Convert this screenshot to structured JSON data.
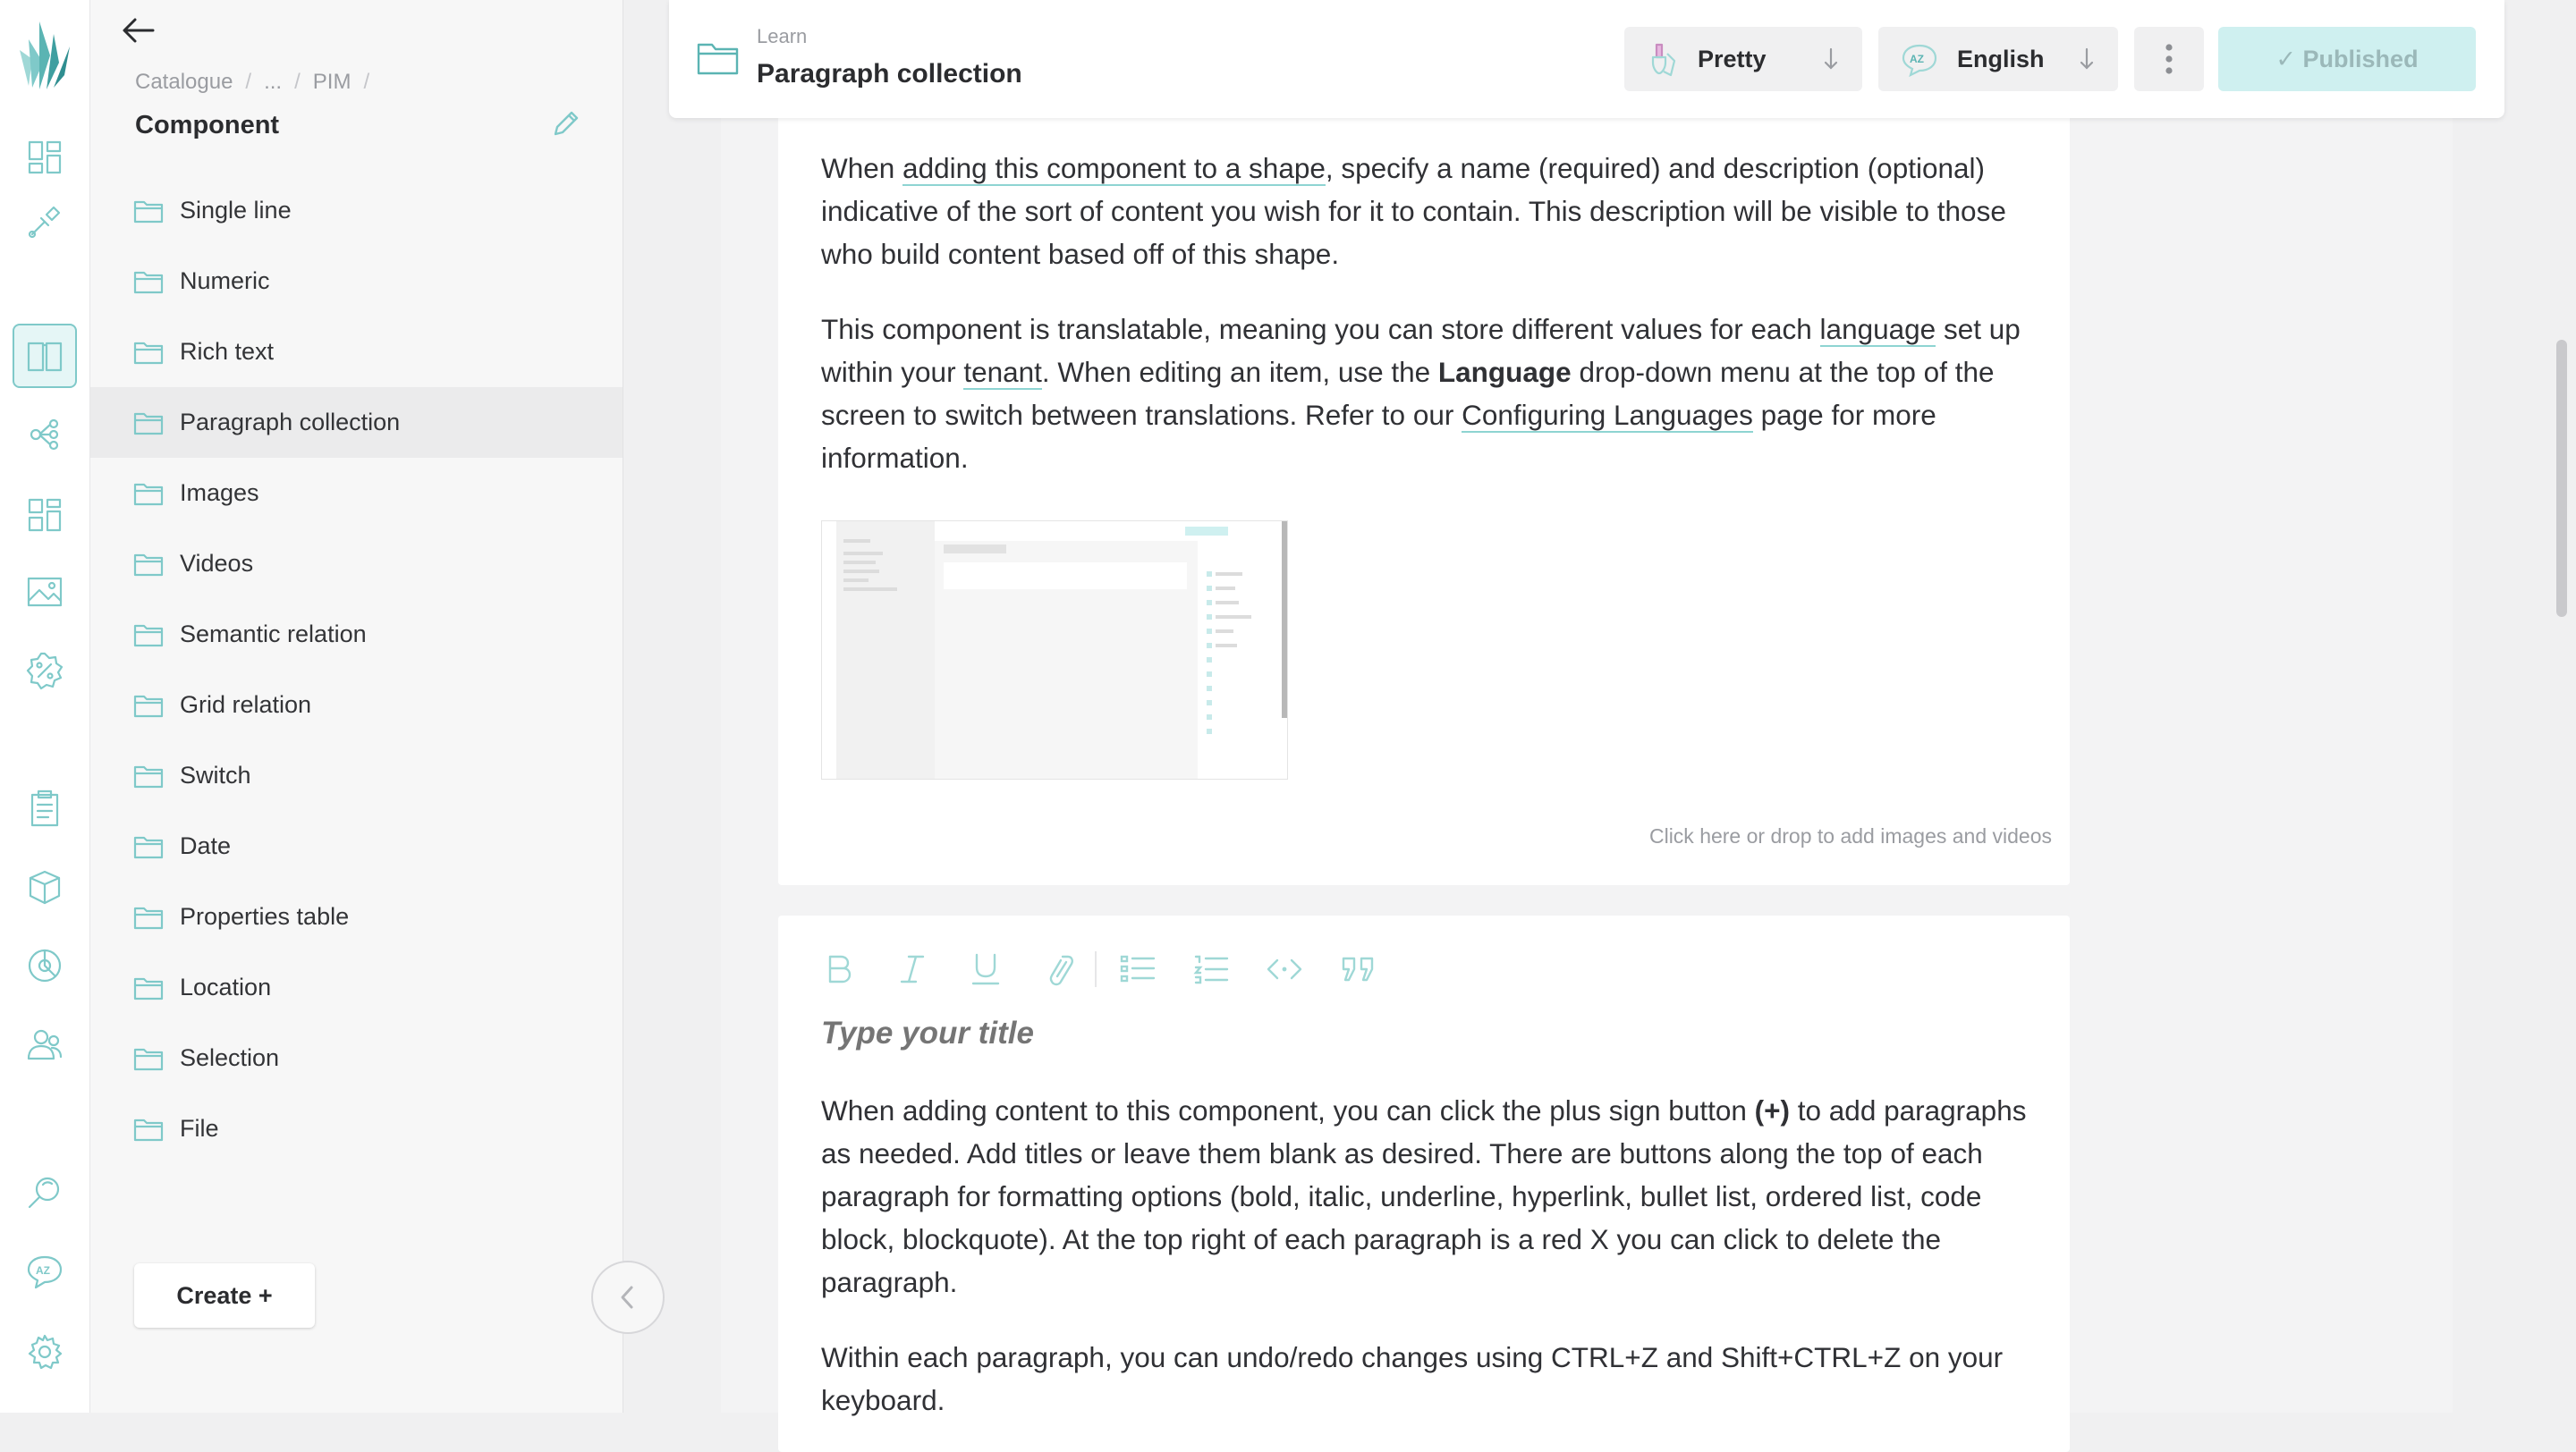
{
  "sidebar_rail": {
    "items": [
      {
        "icon": "dashboard-icon"
      },
      {
        "icon": "pipette-icon"
      },
      {
        "icon": "book-icon"
      },
      {
        "icon": "shapes-icon"
      },
      {
        "icon": "grid-icon"
      },
      {
        "icon": "image-icon"
      },
      {
        "icon": "percent-icon"
      },
      {
        "icon": "clipboard-icon"
      },
      {
        "icon": "box-icon"
      },
      {
        "icon": "chart-pie-icon"
      },
      {
        "icon": "users-icon"
      },
      {
        "icon": "search-icon"
      },
      {
        "icon": "translate-icon"
      },
      {
        "icon": "gear-icon"
      }
    ]
  },
  "tree": {
    "breadcrumb": [
      "Catalogue",
      "...",
      "PIM"
    ],
    "title": "Component",
    "items": [
      {
        "label": "Single line"
      },
      {
        "label": "Numeric"
      },
      {
        "label": "Rich text"
      },
      {
        "label": "Paragraph collection",
        "selected": true
      },
      {
        "label": "Images"
      },
      {
        "label": "Videos"
      },
      {
        "label": "Semantic relation"
      },
      {
        "label": "Grid relation"
      },
      {
        "label": "Switch"
      },
      {
        "label": "Date"
      },
      {
        "label": "Properties table"
      },
      {
        "label": "Location"
      },
      {
        "label": "Selection"
      },
      {
        "label": "File"
      }
    ],
    "create_label": "Create +"
  },
  "header": {
    "breadcrumb": "Learn",
    "title": "Paragraph collection",
    "version_label": "Pretty",
    "language_label": "English",
    "publish_label": "✓ Published"
  },
  "paragraph1": {
    "p1": {
      "before": "When ",
      "link": "adding this component to a shape",
      "after": ", specify a name (required) and description (optional) indicative of the sort of content you wish for it to contain. This description will be visible to those who build content based off of this shape."
    },
    "p2": {
      "t1": "This component is translatable, meaning you can store different values for each ",
      "link1": "language",
      "t2": " set up within your ",
      "link2": "tenant",
      "t3": ". When editing an item, use the ",
      "bold": "Language",
      "t4": " drop-down menu at the top of the screen to switch between translations. Refer to our ",
      "link3": "Configuring Languages",
      "t5": " page for more information."
    },
    "media_hint": "Click here or drop to add images and videos"
  },
  "paragraph2": {
    "title_placeholder": "Type your title",
    "p3": {
      "t1": "When adding content to this component, you can click the plus sign button ",
      "bold": "(+)",
      "t2": " to add paragraphs as needed. Add titles or leave them blank as desired. There are buttons along the top of each paragraph for formatting options (bold, italic, underline, hyperlink, bullet list, ordered list, code block, blockquote). At the top right of each paragraph is a red X you can click to delete the paragraph."
    },
    "p4": "Within each paragraph, you can undo/redo changes using CTRL+Z and Shift+CTRL+Z on your keyboard."
  },
  "colors": {
    "accent": "#7fc9c9",
    "publish_bg": "#cff0f0",
    "selected_row": "#ebebec"
  }
}
